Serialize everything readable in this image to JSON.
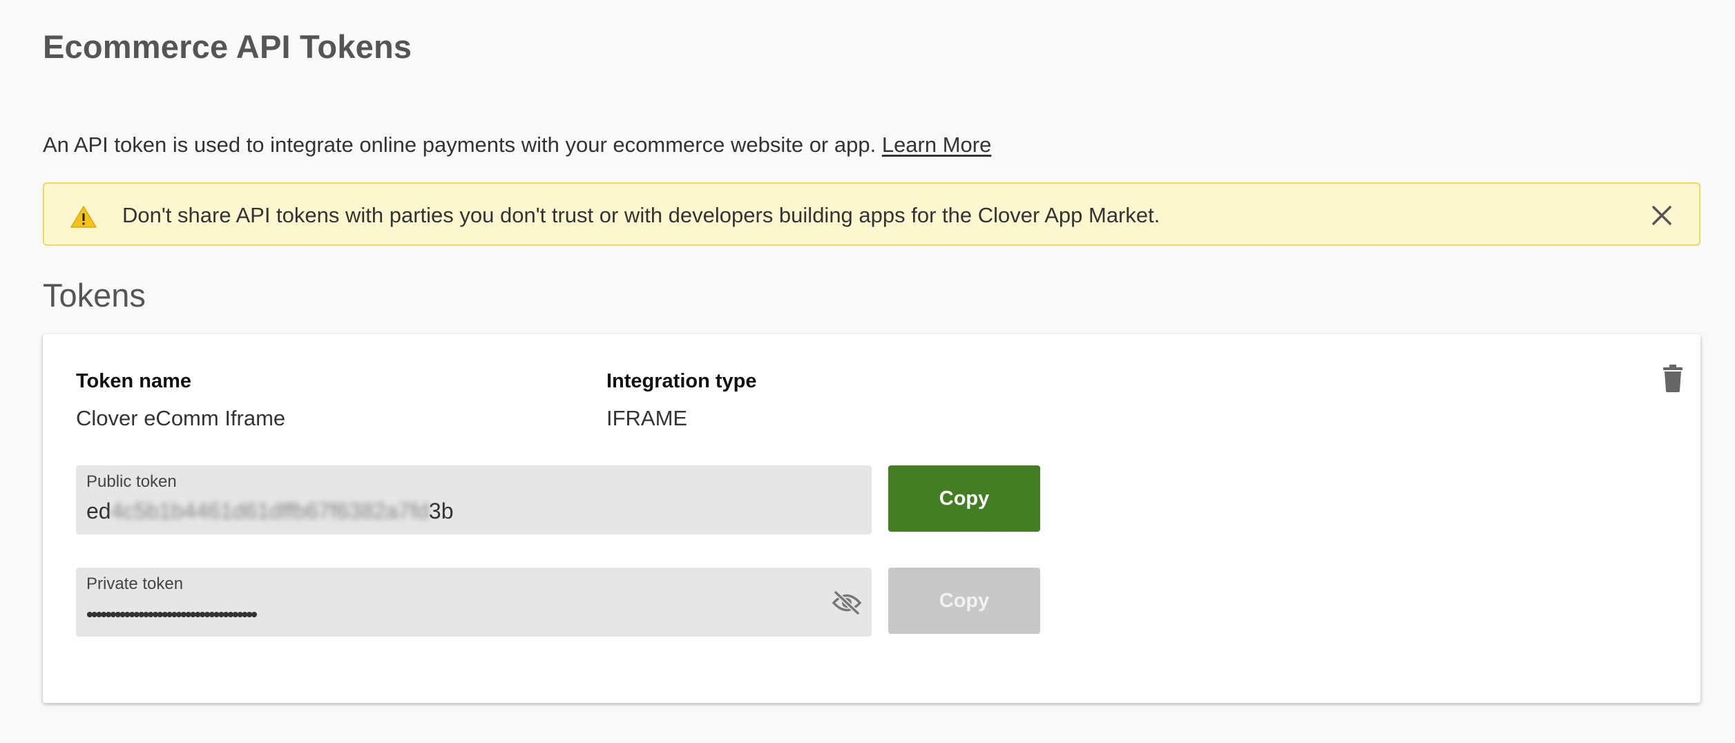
{
  "page": {
    "title": "Ecommerce API Tokens",
    "intro_text": "An API token is used to integrate online payments with your ecommerce website or app.",
    "learn_more_label": "Learn More"
  },
  "warning": {
    "text": "Don't share API tokens with parties you don't trust or with developers building apps for the Clover App Market.",
    "icon": "warning-triangle-icon",
    "close_icon": "close-icon"
  },
  "tokens_section": {
    "title": "Tokens",
    "card": {
      "token_name_label": "Token name",
      "token_name_value": "Clover eComm Iframe",
      "integration_type_label": "Integration type",
      "integration_type_value": "IFRAME",
      "public_token": {
        "label": "Public token",
        "prefix": "ed",
        "obscured_middle": "4c5b1b4461d61dffb67f6382a7fd",
        "suffix": "3b",
        "copy_label": "Copy"
      },
      "private_token": {
        "label": "Private token",
        "masked_value": "••••••••••••••••••••••••••••••••••••",
        "copy_label": "Copy",
        "visibility_icon": "eye-off-icon"
      },
      "delete_icon": "trash-icon"
    }
  },
  "colors": {
    "primary_green": "#437f22",
    "warning_bg": "#fdf7cf",
    "warning_border": "#ecd864",
    "disabled_button": "#c8c8c8"
  }
}
